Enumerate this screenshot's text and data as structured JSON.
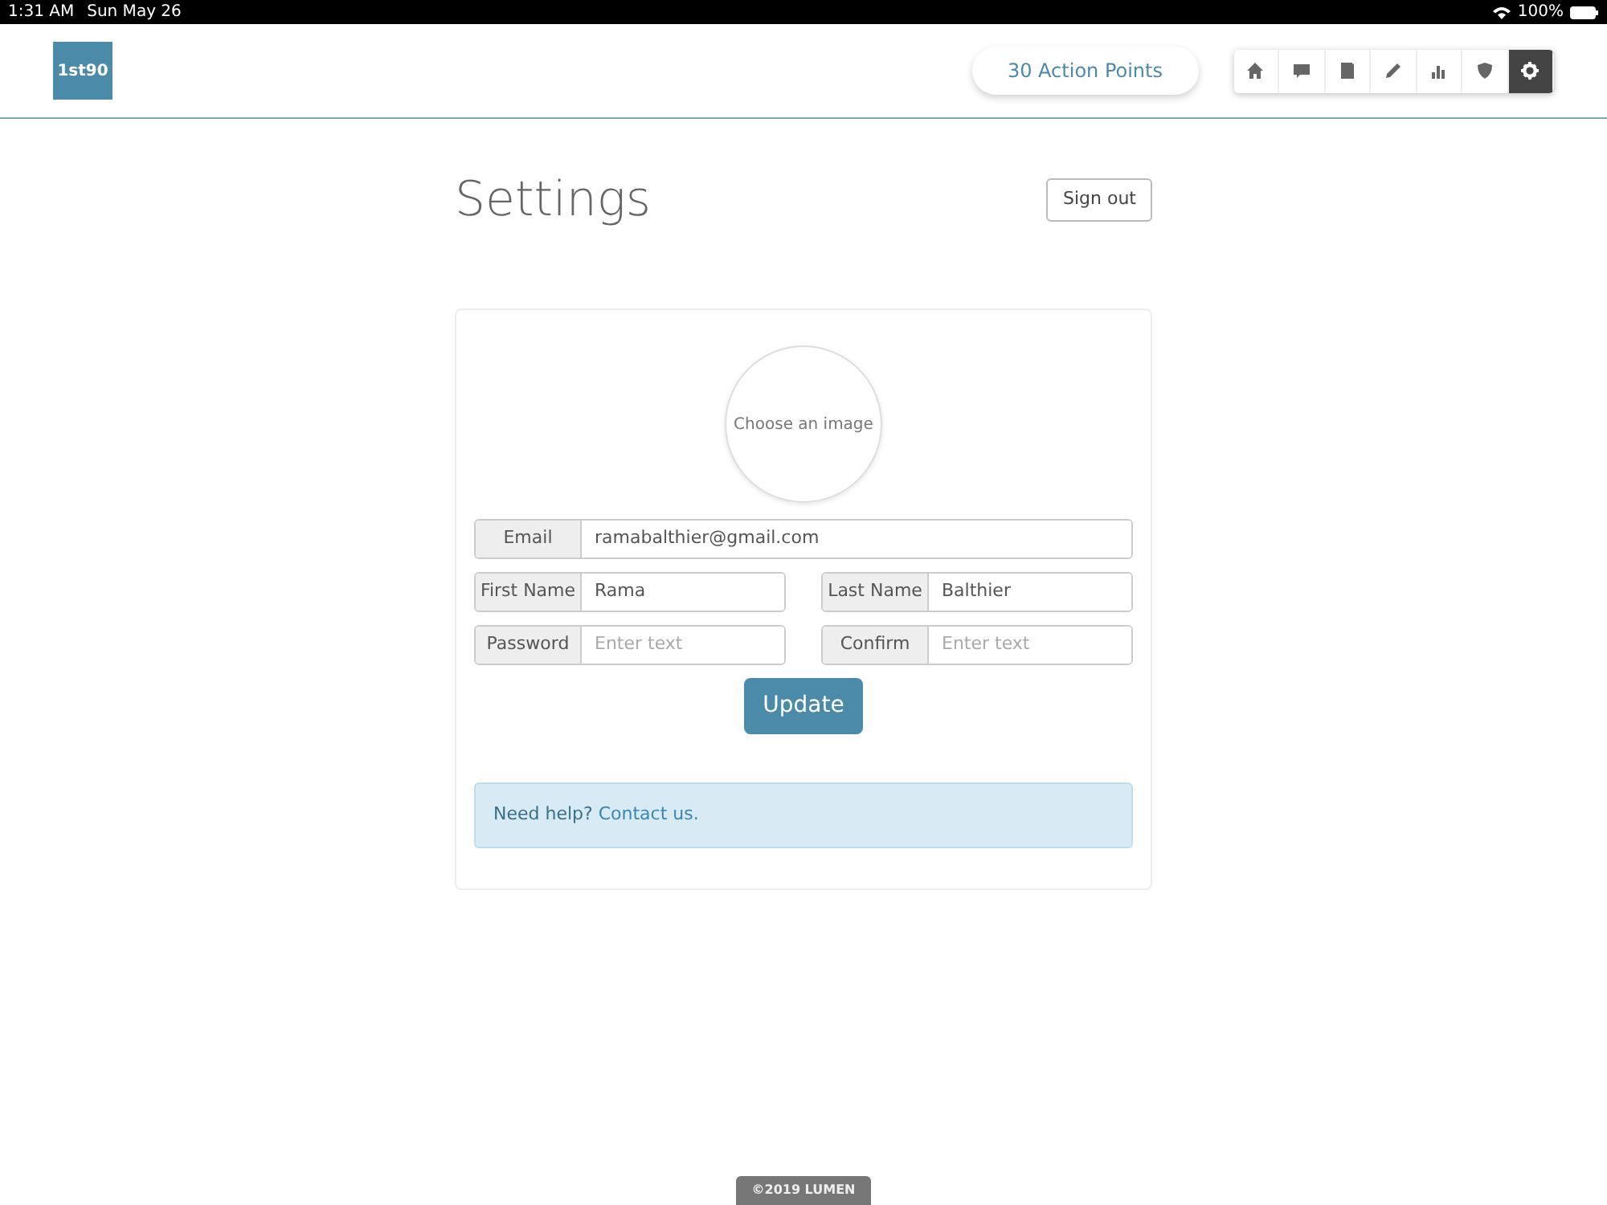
{
  "status_bar": {
    "time": "1:31 AM",
    "date": "Sun May 26",
    "battery": "100%"
  },
  "header": {
    "logo_text": "1st90",
    "points": "30 Action Points",
    "nav": [
      {
        "kind": "home",
        "selected": false
      },
      {
        "kind": "chat",
        "selected": false
      },
      {
        "kind": "book",
        "selected": false
      },
      {
        "kind": "pencil",
        "selected": false
      },
      {
        "kind": "chart",
        "selected": false
      },
      {
        "kind": "shield",
        "selected": false
      },
      {
        "kind": "gear",
        "selected": true
      }
    ]
  },
  "page": {
    "title": "Settings",
    "sign_out": "Sign out"
  },
  "form": {
    "avatar": "Choose an image",
    "rows": [
      [
        {
          "label": "Email",
          "value": "ramabalthier@gmail.com"
        }
      ],
      [
        {
          "label": "First Name",
          "value": "Rama"
        },
        {
          "label": "Last Name",
          "value": "Balthier"
        }
      ],
      [
        {
          "label": "Password",
          "placeholder": "Enter text"
        },
        {
          "label": "Confirm",
          "placeholder": "Enter text"
        }
      ]
    ],
    "submit": "Update",
    "help": {
      "text": "Need help?",
      "link": "Contact us."
    }
  },
  "footer": "©2019 LUMEN"
}
